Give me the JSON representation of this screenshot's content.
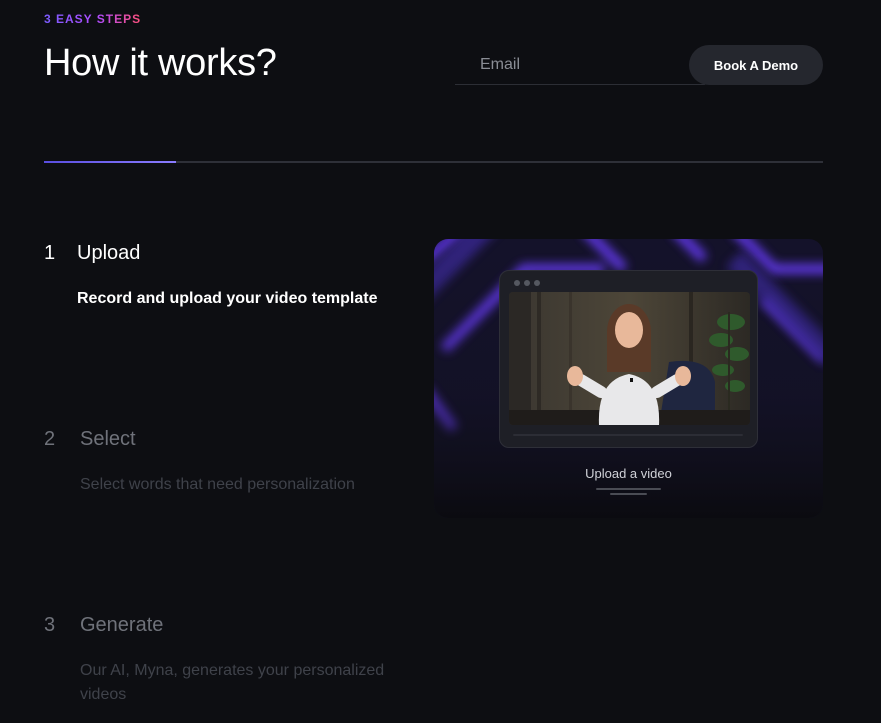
{
  "header": {
    "eyebrow": "3 EASY STEPS",
    "title": "How it works?"
  },
  "email": {
    "placeholder": "Email",
    "value": ""
  },
  "demo_button": {
    "label": "Book A Demo"
  },
  "progress": {
    "fraction": 0.17
  },
  "steps": [
    {
      "number": "1",
      "title": "Upload",
      "description": "Record and upload your video template",
      "active": true
    },
    {
      "number": "2",
      "title": "Select",
      "description": "Select words that need personalization",
      "active": false
    },
    {
      "number": "3",
      "title": "Generate",
      "description": "Our AI, Myna, generates your personalized videos",
      "active": false
    }
  ],
  "preview": {
    "caption": "Upload a video"
  },
  "colors": {
    "background": "#0d0e12",
    "accent": "#7b5cff",
    "button_bg": "#25272e",
    "glow": "#5b2dff"
  }
}
